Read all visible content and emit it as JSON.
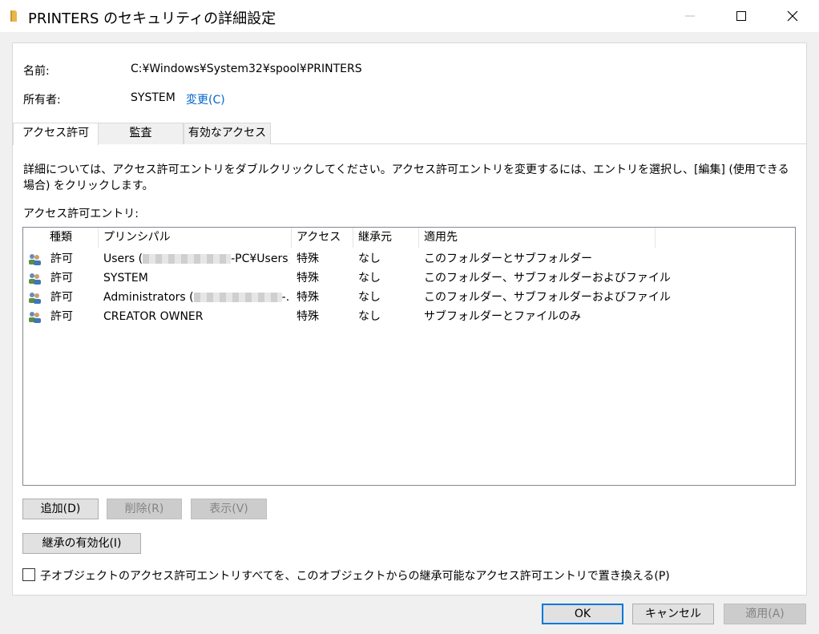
{
  "window": {
    "title": "PRINTERS のセキュリティの詳細設定",
    "folder_icon": "folder-icon"
  },
  "info": {
    "name_label": "名前:",
    "name_value": "C:¥Windows¥System32¥spool¥PRINTERS",
    "owner_label": "所有者:",
    "owner_value": "SYSTEM",
    "owner_change": "変更(C)"
  },
  "tabs": [
    {
      "label": "アクセス許可",
      "active": true
    },
    {
      "label": "監査",
      "active": false
    },
    {
      "label": "有効なアクセス",
      "active": false
    }
  ],
  "description": "詳細については、アクセス許可エントリをダブルクリックしてください。アクセス許可エントリを変更するには、エントリを選択し、[編集] (使用できる場合) をクリックします。",
  "entries_label": "アクセス許可エントリ:",
  "table": {
    "headers": [
      "種類",
      "プリンシパル",
      "アクセス",
      "継承元",
      "適用先"
    ],
    "rows": [
      {
        "type": "許可",
        "principal_prefix": "Users (",
        "principal_suffix": "-PC¥Users)",
        "access": "特殊",
        "inherited": "なし",
        "applies": "このフォルダーとサブフォルダー"
      },
      {
        "type": "許可",
        "principal_prefix": "SYSTEM",
        "principal_suffix": "",
        "access": "特殊",
        "inherited": "なし",
        "applies": "このフォルダー、サブフォルダーおよびファイル"
      },
      {
        "type": "許可",
        "principal_prefix": "Administrators (",
        "principal_suffix": "-...",
        "access": "特殊",
        "inherited": "なし",
        "applies": "このフォルダー、サブフォルダーおよびファイル"
      },
      {
        "type": "許可",
        "principal_prefix": "CREATOR OWNER",
        "principal_suffix": "",
        "access": "特殊",
        "inherited": "なし",
        "applies": "サブフォルダーとファイルのみ"
      }
    ]
  },
  "buttons": {
    "add": "追加(D)",
    "remove": "削除(R)",
    "view": "表示(V)",
    "enable_inheritance": "継承の有効化(I)",
    "ok": "OK",
    "cancel": "キャンセル",
    "apply": "適用(A)"
  },
  "replace_checkbox_label": "子オブジェクトのアクセス許可エントリすべてを、このオブジェクトからの継承可能なアクセス許可エントリで置き換える(P)",
  "colors": {
    "link": "#0066cc",
    "primary_border": "#0078d7"
  }
}
